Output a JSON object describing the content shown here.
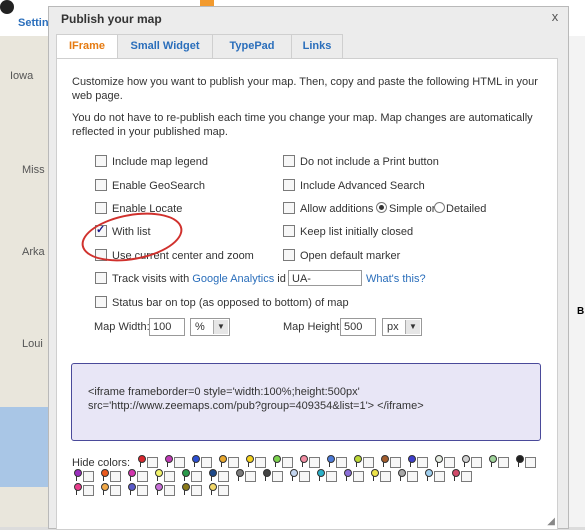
{
  "background": {
    "top_tab": "Settin",
    "map_labels": [
      "Iowa",
      "Miss",
      "Arka",
      "Loui"
    ]
  },
  "dialog": {
    "title": "Publish your map",
    "close_label": "x",
    "tabs": [
      "IFrame",
      "Small Widget",
      "TypePad",
      "Links"
    ],
    "active_tab": "IFrame",
    "intro1": "Customize how you want to publish your map. Then, copy and paste the following HTML in your web page.",
    "intro2": "You do not have to re-publish each time you change your map. Map changes are automatically reflected in your published map.",
    "options_left": [
      {
        "label": "Include map legend",
        "checked": false
      },
      {
        "label": "Enable GeoSearch",
        "checked": false
      },
      {
        "label": "Enable Locate",
        "checked": false
      },
      {
        "label": "With list",
        "checked": true
      },
      {
        "label": "Use current center and zoom",
        "checked": false
      }
    ],
    "options_right": [
      {
        "label": "Do not include a Print button",
        "checked": false
      },
      {
        "label": "Include Advanced Search",
        "checked": false
      },
      {
        "label": "Allow additions",
        "checked": false
      },
      {
        "label": "Keep list initially closed",
        "checked": false
      },
      {
        "label": "Open default marker",
        "checked": false
      }
    ],
    "additions_radio": {
      "simple": "Simple or",
      "detailed": "Detailed",
      "selected": "Simple"
    },
    "track_label_pre": "Track visits with",
    "track_link": "Google Analytics",
    "track_label_id": "id",
    "track_id_value": "UA-",
    "whats_this": "What's this?",
    "status_bar_label": "Status bar on top (as opposed to bottom) of map",
    "map_width_label": "Map Width:",
    "map_width_value": "100",
    "map_width_unit": "%",
    "map_height_label": "Map Height:",
    "map_height_value": "500",
    "map_height_unit": "px",
    "code_line1": "<iframe frameborder=0 style='width:100%;height:500px'",
    "code_line2": "src='http://www.zeemaps.com/pub?group=409354&list=1'> </iframe>",
    "hide_colors_label": "Hide colors:",
    "pin_colors": [
      "#d8262d",
      "#c03bb6",
      "#2c4fd2",
      "#e8a72d",
      "#f4d21f",
      "#7bd24d",
      "#f28ca2",
      "#4c7ad8",
      "#bcd835",
      "#a25c2c",
      "#3d3dcc",
      "#e6ede2",
      "#d1d1d1",
      "#9fd39a",
      "#202020",
      "#9a2fbd",
      "#eb5a1f",
      "#d235ae",
      "#f2f46b",
      "#2a9a4a",
      "#1e4a8a",
      "#7a7a7a",
      "#444444",
      "#c4d6f0",
      "#2ab0c8",
      "#8b6fd8",
      "#ede34a",
      "#a8a8a8",
      "#a0d0f0",
      "#d24a6a",
      "#e83e8c",
      "#f0a848",
      "#5a5ac8",
      "#c870d8",
      "#8a7a1a",
      "#f2d86a"
    ]
  }
}
